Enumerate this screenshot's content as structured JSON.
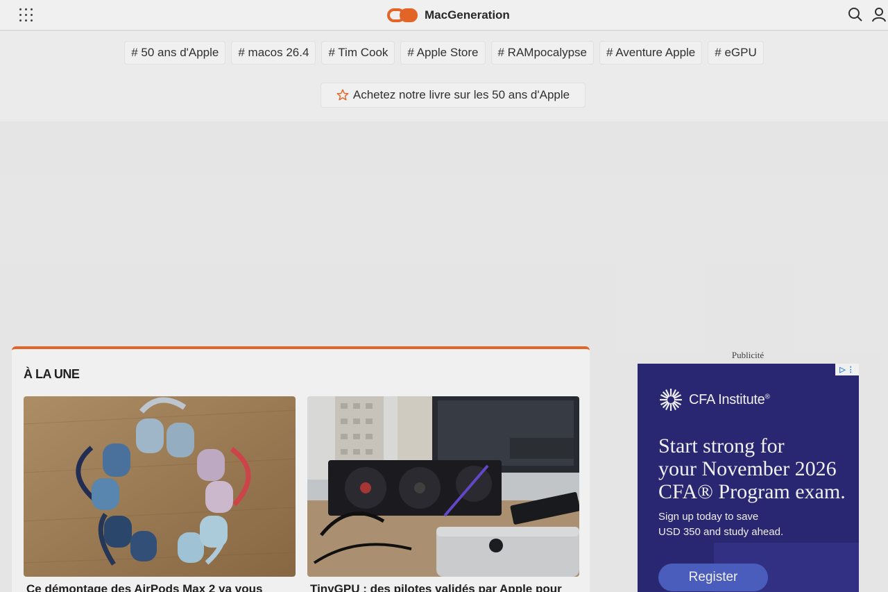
{
  "header": {
    "brand": "MacGeneration"
  },
  "tags": [
    "# 50 ans d'Apple",
    "# macos 26.4",
    "# Tim Cook",
    "# Apple Store",
    "# RAMpocalypse",
    "# Aventure Apple",
    "# eGPU"
  ],
  "promo": {
    "label": "Achetez notre livre sur les 50 ans d'Apple"
  },
  "section": {
    "title": "À LA UNE"
  },
  "articles": [
    {
      "title": "Ce démontage des AirPods Max 2 va vous"
    },
    {
      "title": "TinyGPU : des pilotes validés par Apple pour"
    }
  ],
  "ad": {
    "label": "Publicité",
    "brand": "CFA Institute",
    "registered_mark": "®",
    "headline_1": "Start strong for",
    "headline_2": "your November 2026",
    "headline_3": "CFA® Program exam.",
    "body_1": "Sign up today to save",
    "body_2": "USD 350 and study ahead.",
    "cta": "Register",
    "colors": {
      "background": "#2c2a7a",
      "button": "#4f63c8"
    }
  },
  "colors": {
    "accent": "#f26b2a"
  }
}
